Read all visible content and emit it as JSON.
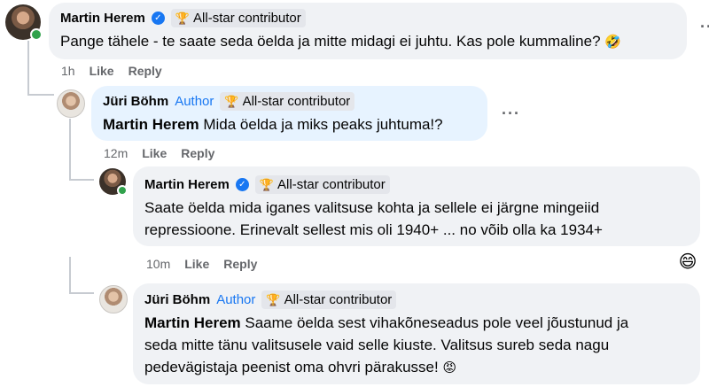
{
  "comments": [
    {
      "name": "Martin Herem",
      "verified": true,
      "badge": "All-star contributor",
      "text": "Pange tähele - te saate seda öelda ja mitte midagi ei juhtu. Kas pole kummaline?",
      "emoji": "🤣",
      "time": "1h",
      "like": "Like",
      "reply": "Reply",
      "more": "···"
    },
    {
      "name": "Jüri Böhm",
      "author_label": "Author",
      "badge": "All-star contributor",
      "mention": "Martin Herem",
      "text": " Mida öelda ja miks peaks juhtuma!?",
      "time": "12m",
      "like": "Like",
      "reply": "Reply",
      "more": "···"
    },
    {
      "name": "Martin Herem",
      "verified": true,
      "badge": "All-star contributor",
      "text_line1": "Saate öelda mida iganes valitsuse kohta ja sellele ei järgne mingeiid",
      "text_line2": "repressioone. Erinevalt sellest mis oli 1940+ ... no võib olla ka 1934+",
      "time": "10m",
      "like": "Like",
      "reply": "Reply",
      "reaction": "😄"
    },
    {
      "name": "Jüri Böhm",
      "author_label": "Author",
      "badge": "All-star contributor",
      "mention": "Martin Herem",
      "text_line1": " Saame öelda sest vihakõneseadus pole veel jõustunud ja",
      "text_line2": "seda mitte tänu valitsusele vaid selle kiuste. Valitsus sureb seda nagu",
      "text_line3": "pedevägistaja peenist oma ohvri pärakusse!",
      "emoji": "😡"
    }
  ],
  "colors": {
    "bubble": "#f0f2f5",
    "bubble_highlight": "#e7f3ff",
    "link": "#1877f2",
    "secondary_text": "#65676b",
    "online": "#31a24c"
  }
}
